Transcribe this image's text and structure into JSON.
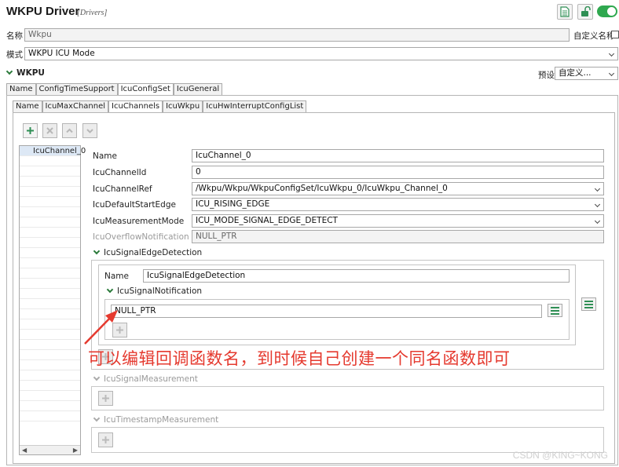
{
  "header": {
    "title": "WKPU Driver",
    "subtitle": "[Drivers]",
    "accent": "#2fa84f"
  },
  "name_row": {
    "label": "名称",
    "value": "Wkpu",
    "custom_name_label": "自定义名称"
  },
  "mode_row": {
    "label": "模式",
    "value": "WKPU ICU Mode"
  },
  "section": {
    "title": "WKPU",
    "preset_label": "预设",
    "preset_value": "自定义..."
  },
  "top_tabs": [
    {
      "label": "Name"
    },
    {
      "label": "ConfigTimeSupport"
    },
    {
      "label": "IcuConfigSet"
    },
    {
      "label": "IcuGeneral"
    }
  ],
  "sub_tabs": [
    {
      "label": "Name"
    },
    {
      "label": "IcuMaxChannel"
    },
    {
      "label": "IcuChannels"
    },
    {
      "label": "IcuWkpu"
    },
    {
      "label": "IcuHwInterruptConfigList"
    }
  ],
  "channel_list": {
    "items": [
      "IcuChannel_0"
    ]
  },
  "form": {
    "name": {
      "label": "Name",
      "value": "IcuChannel_0"
    },
    "channel_id": {
      "label": "IcuChannelId",
      "value": "0"
    },
    "channel_ref": {
      "label": "IcuChannelRef",
      "value": "/Wkpu/Wkpu/WkpuConfigSet/IcuWkpu_0/IcuWkpu_Channel_0"
    },
    "start_edge": {
      "label": "IcuDefaultStartEdge",
      "value": "ICU_RISING_EDGE"
    },
    "meas_mode": {
      "label": "IcuMeasurementMode",
      "value": "ICU_MODE_SIGNAL_EDGE_DETECT"
    },
    "overflow": {
      "label": "IcuOverflowNotification",
      "value": "NULL_PTR"
    }
  },
  "edge_detection": {
    "title": "IcuSignalEdgeDetection",
    "name_label": "Name",
    "name_value": "IcuSignalEdgeDetection",
    "notification_title": "IcuSignalNotification",
    "notification_value": "NULL_PTR"
  },
  "collapsed": {
    "measurement": "IcuSignalMeasurement",
    "timestamp": "IcuTimestampMeasurement"
  },
  "annotation": {
    "text": "可以编辑回调函数名，到时候自己创建一个同名函数即可",
    "color": "#e53a2f"
  },
  "watermark": "CSDN @KING~KONG",
  "icons": [
    "file-icon",
    "lock-icon",
    "add-icon",
    "remove-icon",
    "move-up-icon",
    "move-down-icon",
    "list-menu-icon"
  ]
}
